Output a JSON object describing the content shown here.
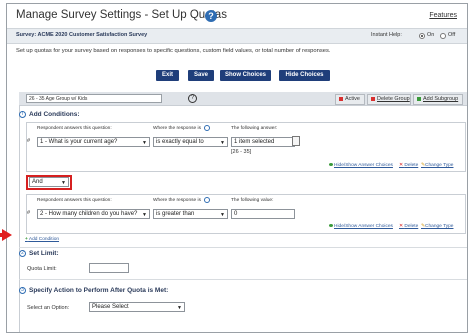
{
  "header": {
    "title": "Manage Survey Settings - Set Up Quotas",
    "help_icon": "?",
    "features_link": "Features"
  },
  "survey_bar": {
    "name": "Survey: ACME 2020 Customer Satisfaction Survey",
    "instant_help_label": "Instant Help:",
    "on_label": "On",
    "off_label": "Off",
    "instant_help_selected": "On"
  },
  "intro": "Set up quotas for your survey based on responses to specific questions, custom field values, or total number of responses.",
  "buttons": {
    "exit": "Exit",
    "save": "Save",
    "show_choices": "Show Choices",
    "hide_choices": "Hide Choices"
  },
  "group": {
    "name": "26 - 35 Age Group w/ Kids",
    "help": "?",
    "tabs": {
      "active": "Active",
      "delete_group": "Delete Group",
      "add_subgroup": "Add Subgroup"
    },
    "colors": {
      "active": "#d83030",
      "delete": "#d83030",
      "add": "#3a9a3a"
    }
  },
  "add_conditions": {
    "title": "Add Conditions:",
    "icon": "i"
  },
  "condition1": {
    "hash": "#",
    "col1_label": "Respondent answers this question:",
    "col2_label": "Where the response is",
    "col3_label": "The following answer:",
    "question": "1 - What is your current age?",
    "operator": "is exactly equal to",
    "answer_selected": "1 item selected",
    "answer_value": "[26 - 35]",
    "actions": {
      "show_hide": "Hide/Show Answer Choices",
      "delete": "Delete",
      "change_type": "Change Type"
    }
  },
  "logic": {
    "value": "And"
  },
  "condition2": {
    "hash": "#",
    "col1_label": "Respondent answers this question:",
    "col2_label": "Where the response is",
    "col3_label": "The following value:",
    "question": "2 - How many children do you have?",
    "operator": "is greater than",
    "value": "0",
    "actions": {
      "show_hide": "Hide/Show Answer Choices",
      "delete": "Delete",
      "change_type": "Change Type"
    }
  },
  "add_condition_link": "Add Condition",
  "set_limit": {
    "title": "Set Limit:",
    "icon": "2",
    "quota_label": "Quota Limit:",
    "quota_value": ""
  },
  "action_section": {
    "title": "Specify Action to Perform After Quota is Met:",
    "icon": "3",
    "select_label": "Select an Option:",
    "select_value": "Please Select"
  }
}
